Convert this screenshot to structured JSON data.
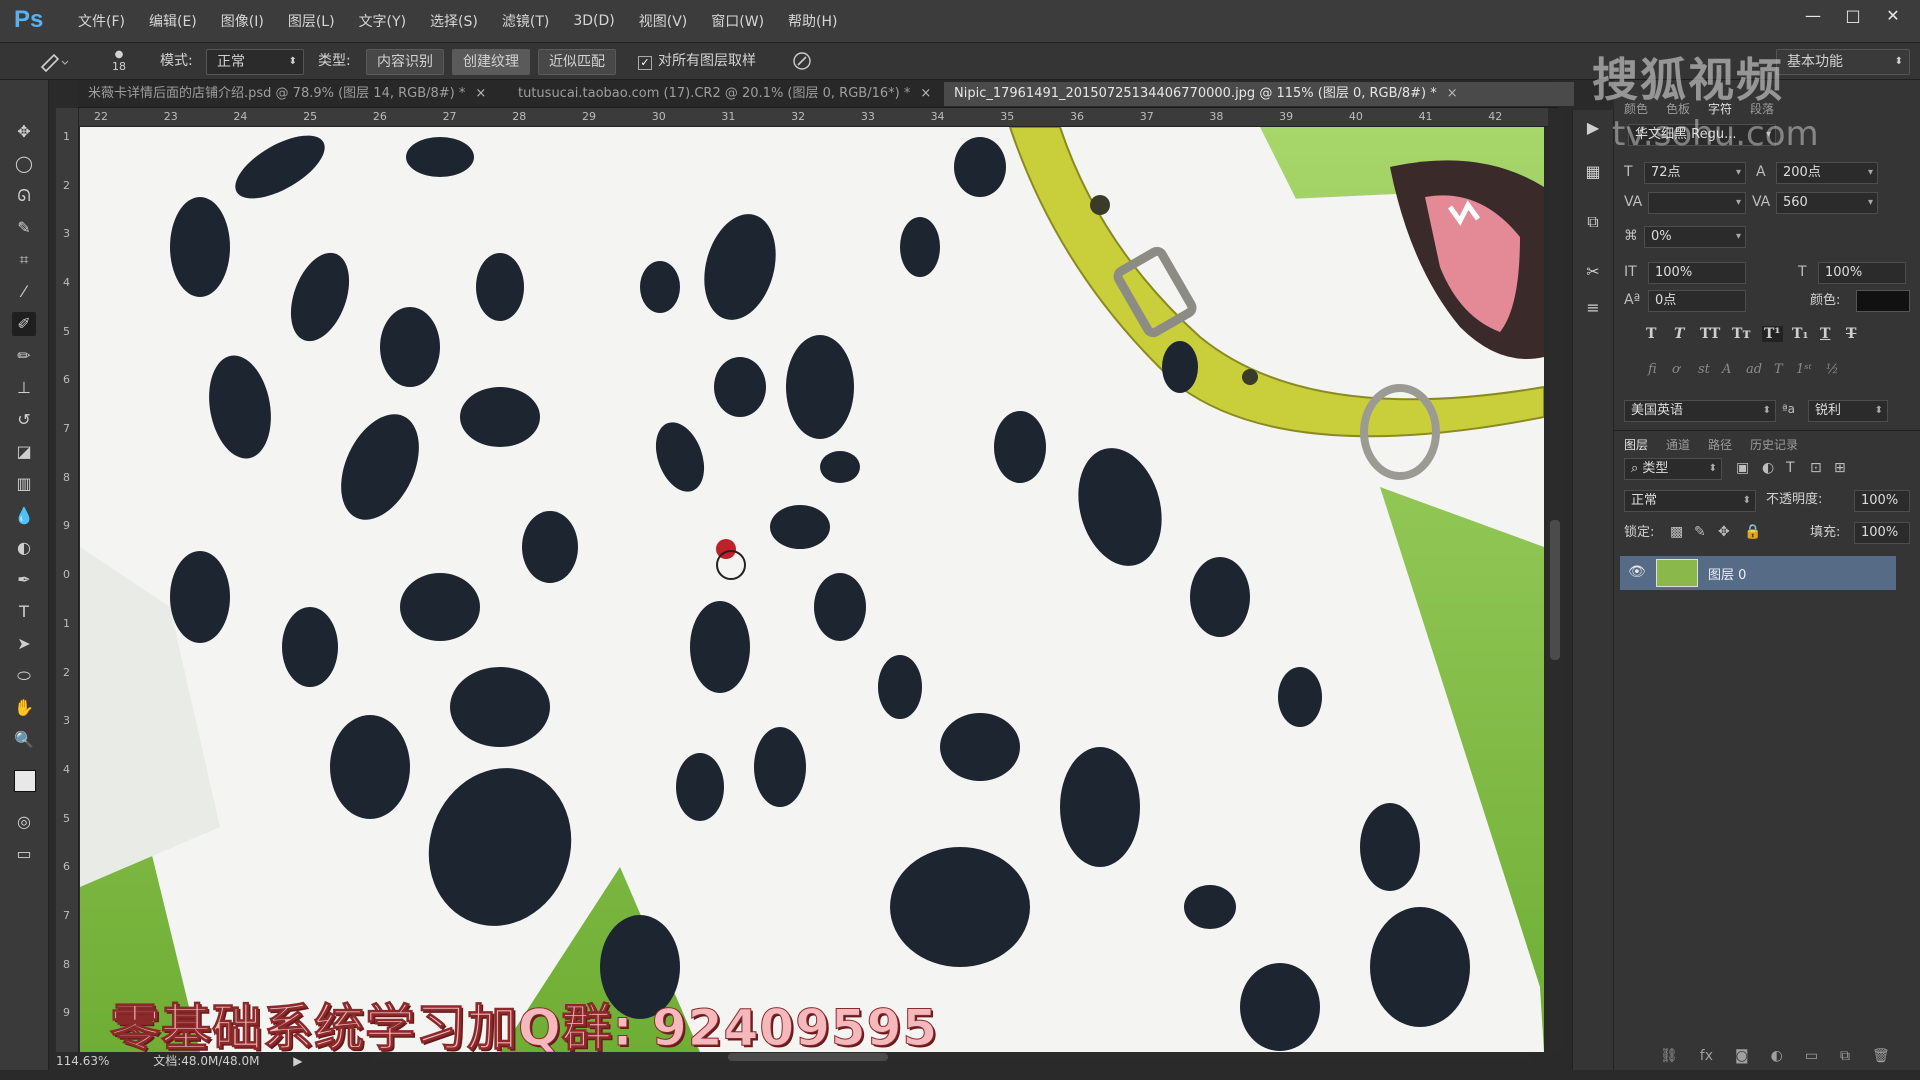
{
  "app": {
    "logo": "Ps"
  },
  "menu": [
    "文件(F)",
    "编辑(E)",
    "图像(I)",
    "图层(L)",
    "文字(Y)",
    "选择(S)",
    "滤镜(T)",
    "3D(D)",
    "视图(V)",
    "窗口(W)",
    "帮助(H)"
  ],
  "window_controls": {
    "minimize": "—",
    "maximize": "□",
    "close": "✕"
  },
  "options": {
    "brush_size": "18",
    "mode_label": "模式:",
    "mode_value": "正常",
    "type_label": "类型:",
    "type_options": [
      "内容识别",
      "创建纹理",
      "近似匹配"
    ],
    "sample_all_label": "对所有图层取样",
    "sample_all_checked": true,
    "workspace": "基本功能"
  },
  "tabs": [
    {
      "label": "米薇卡详情后面的店铺介绍.psd @ 78.9% (图层 14, RGB/8#) *",
      "active": false
    },
    {
      "label": "tutusucai.taobao.com (17).CR2 @ 20.1% (图层 0, RGB/16*) *",
      "active": false
    },
    {
      "label": "Nipic_17961491_20150725134406770000.jpg @ 115% (图层 0, RGB/8#) *",
      "active": true
    }
  ],
  "rulers": {
    "top": [
      "22",
      "23",
      "24",
      "25",
      "26",
      "27",
      "28",
      "29",
      "30",
      "31",
      "32",
      "33",
      "34",
      "35",
      "36",
      "37",
      "38",
      "39",
      "40",
      "41",
      "42"
    ],
    "left": [
      "1",
      "2",
      "3",
      "4",
      "5",
      "6",
      "7",
      "8",
      "9",
      "0",
      "1",
      "2",
      "3",
      "4",
      "5",
      "6",
      "7",
      "8",
      "9"
    ]
  },
  "status": {
    "zoom": "114.63%",
    "doc": "文档:48.0M/48.0M"
  },
  "watermark": {
    "brand": "搜狐视频",
    "url": "tv.sohu.com"
  },
  "overlay_caption": "零基础系统学习加Q群: 92409595",
  "character_panel": {
    "tabs": [
      "颜色",
      "色板",
      "字符",
      "段落"
    ],
    "font_family": "华文细黑 Regu...",
    "font_size": "72点",
    "leading": "200点",
    "kerning": "",
    "tracking": "560",
    "scale_pct": "0%",
    "vertical_scale": "100%",
    "horizontal_scale": "100%",
    "baseline": "0点",
    "color_label": "颜色:",
    "type_buttons": [
      "T",
      "T",
      "TT",
      "Tт",
      "T¹",
      "T₁",
      "T",
      "T"
    ],
    "language": "美国英语",
    "aa_label": "ªa",
    "antialias": "锐利"
  },
  "layers_panel": {
    "tabs": [
      "图层",
      "通道",
      "路径",
      "历史记录"
    ],
    "filter_label": "类型",
    "blend_mode": "正常",
    "opacity_label": "不透明度:",
    "opacity": "100%",
    "lock_label": "锁定:",
    "fill_label": "填充:",
    "fill": "100%",
    "layers": [
      {
        "name": "图层 0",
        "visible": true
      }
    ],
    "bottom_icons": [
      "link-icon",
      "fx-icon",
      "mask-icon",
      "adjustment-icon",
      "group-icon",
      "new-layer-icon",
      "trash-icon"
    ],
    "fx_label": "fx"
  },
  "colors": {
    "accent": "#5ab1f2",
    "layer_selected": "#566b86",
    "grass": "#7fbd3e",
    "collar": "#c9cf3a"
  }
}
